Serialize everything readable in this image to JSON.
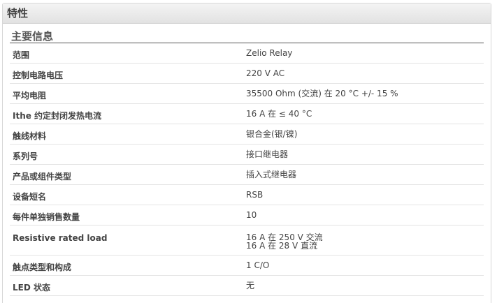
{
  "panel": {
    "title": "特性"
  },
  "section": {
    "title": "主要信息"
  },
  "rows": [
    {
      "label": "范围",
      "values": [
        "Zelio Relay"
      ]
    },
    {
      "label": "控制电路电压",
      "values": [
        "220 V AC"
      ]
    },
    {
      "label": "平均电阻",
      "values": [
        "35500 Ohm (交流) 在 20 °C +/- 15 %"
      ]
    },
    {
      "label": "Ithe 约定封闭发热电流",
      "values": [
        "16 A 在 ≤ 40 °C"
      ]
    },
    {
      "label": "触线材料",
      "values": [
        "银合金(银/镍)"
      ]
    },
    {
      "label": "系列号",
      "values": [
        "接口继电器"
      ]
    },
    {
      "label": "产品或组件类型",
      "values": [
        "插入式继电器"
      ]
    },
    {
      "label": "设备短名",
      "values": [
        "RSB"
      ]
    },
    {
      "label": "每件单独销售数量",
      "values": [
        "10"
      ]
    },
    {
      "label": "Resistive rated load",
      "values": [
        "16 A 在 250 V 交流",
        "16 A 在 28 V 直流"
      ]
    },
    {
      "label": "触点类型和构成",
      "values": [
        "1 C/O"
      ]
    },
    {
      "label": "LED 状态",
      "values": [
        "无"
      ]
    }
  ]
}
